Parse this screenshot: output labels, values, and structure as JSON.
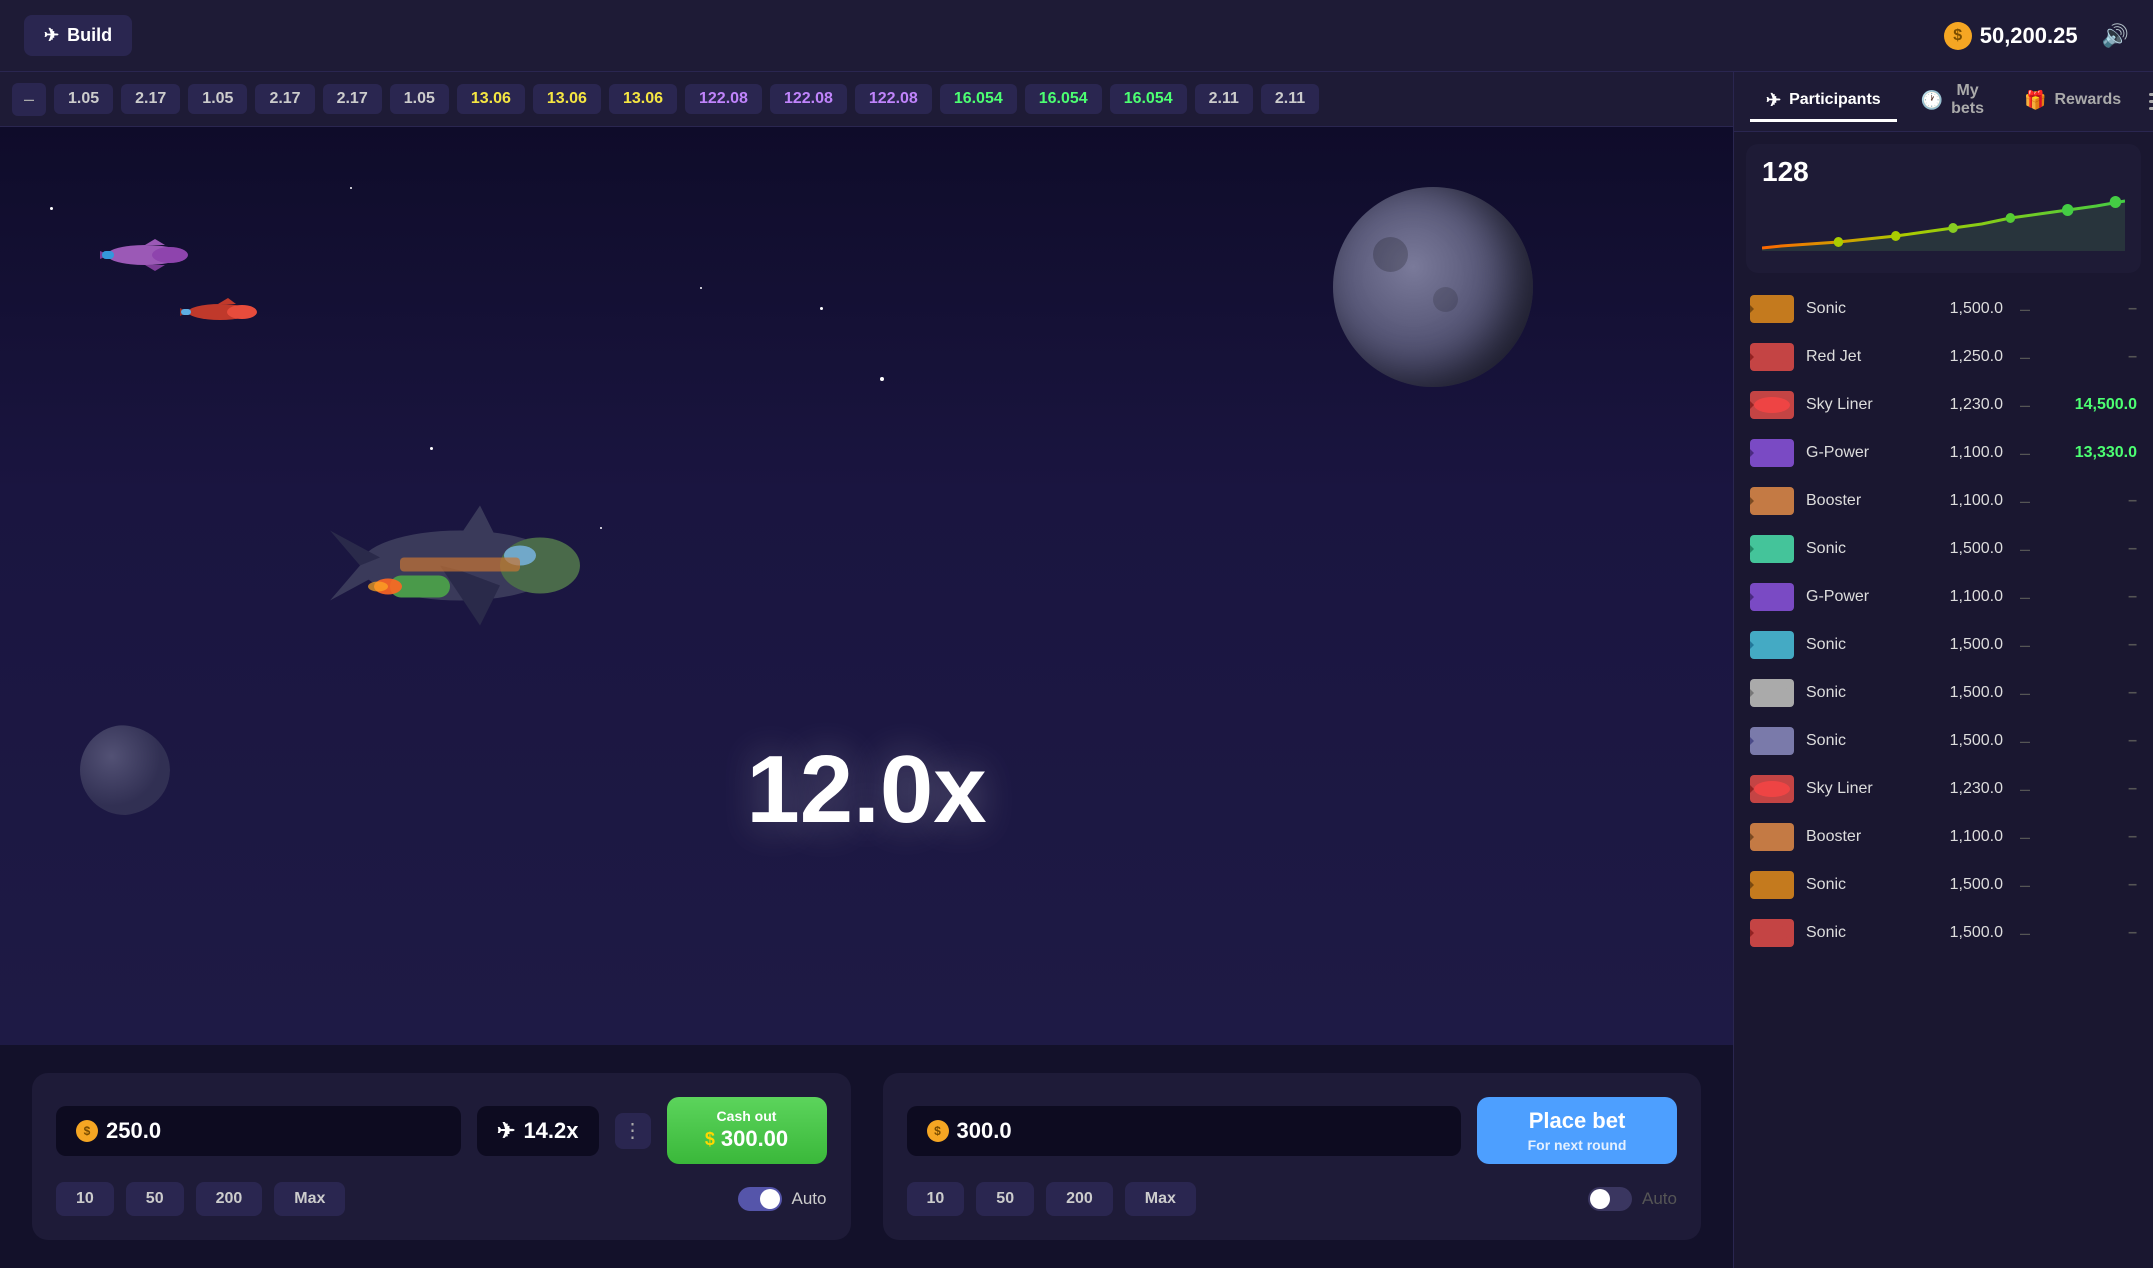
{
  "header": {
    "build_label": "Build",
    "balance": "50,200.25",
    "coin_symbol": "●"
  },
  "ticker": {
    "items": [
      {
        "value": "1.05",
        "color": "default"
      },
      {
        "value": "2.17",
        "color": "default"
      },
      {
        "value": "1.05",
        "color": "default"
      },
      {
        "value": "2.17",
        "color": "default"
      },
      {
        "value": "2.17",
        "color": "default"
      },
      {
        "value": "1.05",
        "color": "default"
      },
      {
        "value": "13.06",
        "color": "yellow"
      },
      {
        "value": "13.06",
        "color": "yellow"
      },
      {
        "value": "13.06",
        "color": "yellow"
      },
      {
        "value": "122.08",
        "color": "purple"
      },
      {
        "value": "122.08",
        "color": "purple"
      },
      {
        "value": "122.08",
        "color": "purple"
      },
      {
        "value": "16.054",
        "color": "green"
      },
      {
        "value": "16.054",
        "color": "green"
      },
      {
        "value": "16.054",
        "color": "green"
      },
      {
        "value": "2.11",
        "color": "default"
      },
      {
        "value": "2.11",
        "color": "default"
      }
    ]
  },
  "game": {
    "multiplier": "12.0x"
  },
  "bet_panel_1": {
    "amount": "250.0",
    "multiplier_val": "14.2x",
    "cash_out_label": "Cash out",
    "cash_out_amount": "300.00",
    "quick_bets": [
      "10",
      "50",
      "200",
      "Max"
    ],
    "auto_label": "Auto",
    "auto_on": true
  },
  "bet_panel_2": {
    "amount": "300.0",
    "place_bet_main": "Place bet",
    "place_bet_sub": "For next round",
    "quick_bets": [
      "10",
      "50",
      "200",
      "Max"
    ],
    "auto_label": "Auto",
    "auto_on": false
  },
  "right_panel": {
    "tabs": [
      {
        "id": "participants",
        "label": "Participants",
        "active": true
      },
      {
        "id": "my_bets",
        "label": "My bets",
        "active": false
      },
      {
        "id": "rewards",
        "label": "Rewards",
        "active": false
      }
    ],
    "chart": {
      "count": "128"
    },
    "participants": [
      {
        "name": "Sonic",
        "bet": "1,500.0",
        "win": null,
        "avatar_color": "#c47a1e"
      },
      {
        "name": "Red Jet",
        "bet": "1,250.0",
        "win": null,
        "avatar_color": "#c44444"
      },
      {
        "name": "Sky Liner",
        "bet": "1,230.0",
        "win": "14,500.0",
        "avatar_color": "#c44444"
      },
      {
        "name": "G-Power",
        "bet": "1,100.0",
        "win": "13,330.0",
        "avatar_color": "#7a4ac4"
      },
      {
        "name": "Booster",
        "bet": "1,100.0",
        "win": null,
        "avatar_color": "#c47a44"
      },
      {
        "name": "Sonic",
        "bet": "1,500.0",
        "win": null,
        "avatar_color": "#44c49a"
      },
      {
        "name": "G-Power",
        "bet": "1,100.0",
        "win": null,
        "avatar_color": "#7a4ac4"
      },
      {
        "name": "Sonic",
        "bet": "1,500.0",
        "win": null,
        "avatar_color": "#44aac4"
      },
      {
        "name": "Sonic",
        "bet": "1,500.0",
        "win": null,
        "avatar_color": "#aaaaaa"
      },
      {
        "name": "Sonic",
        "bet": "1,500.0",
        "win": null,
        "avatar_color": "#7a7aaa"
      },
      {
        "name": "Sky Liner",
        "bet": "1,230.0",
        "win": null,
        "avatar_color": "#c44444"
      },
      {
        "name": "Booster",
        "bet": "1,100.0",
        "win": null,
        "avatar_color": "#c47a44"
      },
      {
        "name": "Sonic",
        "bet": "1,500.0",
        "win": null,
        "avatar_color": "#c47a1e"
      },
      {
        "name": "Sonic",
        "bet": "1,500.0",
        "win": null,
        "avatar_color": "#c44444"
      }
    ]
  }
}
